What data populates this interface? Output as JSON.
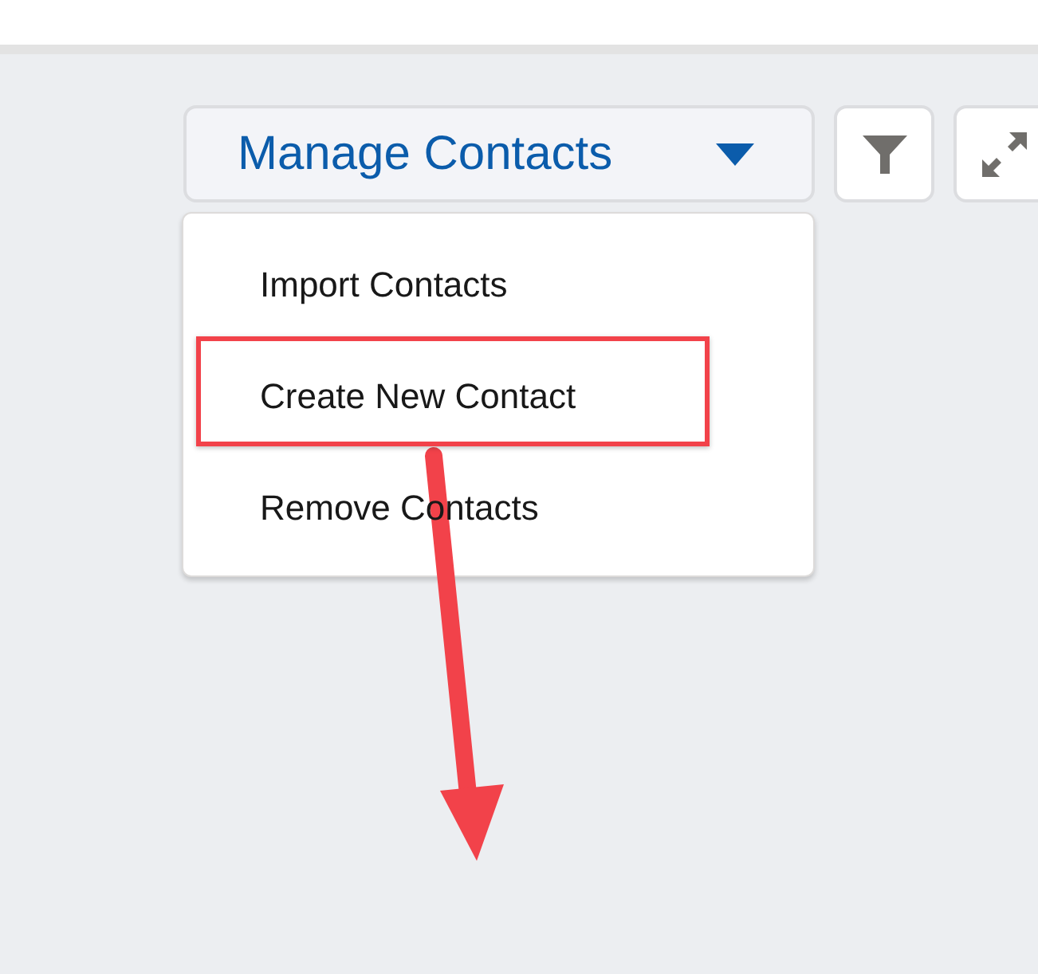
{
  "menu_button": {
    "label": "Manage Contacts",
    "expanded": true
  },
  "toolbar_buttons": [
    {
      "kind": "filter"
    },
    {
      "kind": "expand"
    }
  ],
  "menu_items": [
    {
      "label": "Import Contacts",
      "highlighted": false
    },
    {
      "label": "Create New Contact",
      "highlighted": true
    },
    {
      "label": "Remove Contacts",
      "highlighted": false
    }
  ]
}
